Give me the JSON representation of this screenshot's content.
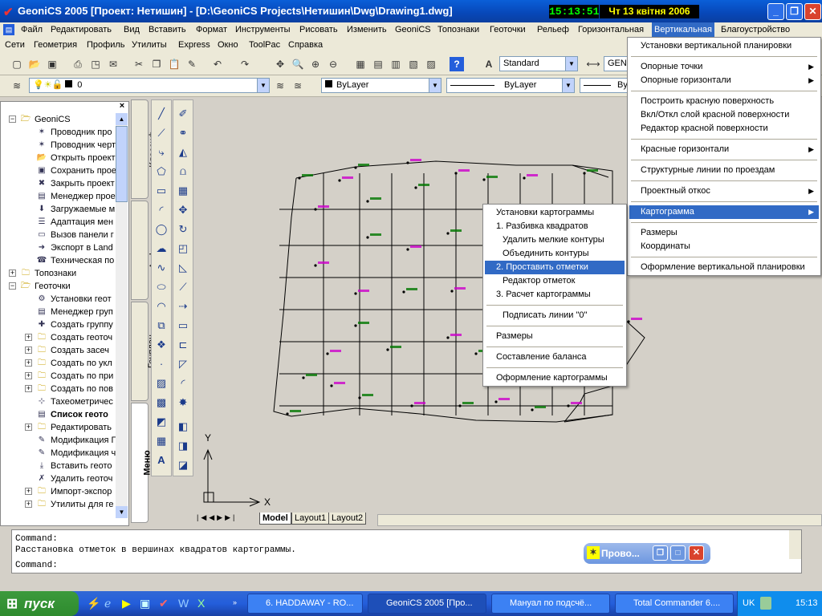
{
  "window": {
    "title": "GeoniCS 2005 [Проект: Нетишин] - [D:\\GeoniCS Projects\\Нетишин\\Dwg\\Drawing1.dwg]",
    "clock_time": "15:13:51",
    "clock_date": "Чт 13 квітня 2006"
  },
  "menubar1": [
    "Файл",
    "Редактировать",
    "Вид",
    "Вставить",
    "Формат",
    "Инструменты",
    "Рисовать",
    "Изменить",
    "GeoniCS",
    "Топознаки",
    "Геоточки",
    "Рельеф",
    "Горизонтальная",
    "Вертикальная",
    "Благоустройство"
  ],
  "menubar2": [
    "Сети",
    "Геометрия",
    "Профиль",
    "Утилиты",
    "Express",
    "Окно",
    "ToolPac",
    "Справка"
  ],
  "toolbar": {
    "text_style": "Standard",
    "dim_style_partial": "GEN",
    "layer": "0",
    "color": "ByLayer",
    "linetype": "ByLayer",
    "lineweight_partial": "By"
  },
  "tree": [
    {
      "label": "GeoniCS",
      "expander": "−",
      "level": 0,
      "icon": "folder-open"
    },
    {
      "label": "Проводник про",
      "level": 1,
      "icon": "explorer"
    },
    {
      "label": "Проводник черт",
      "level": 1,
      "icon": "explorer"
    },
    {
      "label": "Открыть проект",
      "level": 1,
      "icon": "open"
    },
    {
      "label": "Сохранить прое",
      "level": 1,
      "icon": "save"
    },
    {
      "label": "Закрыть проект",
      "level": 1,
      "icon": "close"
    },
    {
      "label": "Менеджер прое",
      "level": 1,
      "icon": "manager"
    },
    {
      "label": "Загружаемые м",
      "level": 1,
      "icon": "load"
    },
    {
      "label": "Адаптация мен",
      "level": 1,
      "icon": "menu"
    },
    {
      "label": "Вызов панели г",
      "level": 1,
      "icon": "panel"
    },
    {
      "label": "Экспорт в Land",
      "level": 1,
      "icon": "export"
    },
    {
      "label": "Техническая по",
      "level": 1,
      "icon": "help"
    },
    {
      "label": "Топознаки",
      "expander": "+",
      "level": 0,
      "icon": "folder"
    },
    {
      "label": "Геоточки",
      "expander": "−",
      "level": 0,
      "icon": "folder-open"
    },
    {
      "label": "Установки геот",
      "level": 1,
      "icon": "settings"
    },
    {
      "label": "Менеджер груп",
      "level": 1,
      "icon": "manager"
    },
    {
      "label": "Создать группу",
      "level": 1,
      "icon": "create"
    },
    {
      "label": "Создать геоточ",
      "expander": "+",
      "level": 1,
      "icon": "folder"
    },
    {
      "label": "Создать засеч",
      "expander": "+",
      "level": 1,
      "icon": "folder"
    },
    {
      "label": "Создать по укл",
      "expander": "+",
      "level": 1,
      "icon": "folder"
    },
    {
      "label": "Создать по при",
      "expander": "+",
      "level": 1,
      "icon": "folder"
    },
    {
      "label": "Создать по пов",
      "expander": "+",
      "level": 1,
      "icon": "folder"
    },
    {
      "label": "Тахеометричес",
      "level": 1,
      "icon": "tacheo"
    },
    {
      "label": "Список геото",
      "level": 1,
      "icon": "list",
      "bold": true
    },
    {
      "label": "Редактировать",
      "expander": "+",
      "level": 1,
      "icon": "folder"
    },
    {
      "label": "Модификация Г",
      "level": 1,
      "icon": "modify"
    },
    {
      "label": "Модификация ч",
      "level": 1,
      "icon": "modify"
    },
    {
      "label": "Вставить геото",
      "level": 1,
      "icon": "insert"
    },
    {
      "label": "Удалить геоточ",
      "level": 1,
      "icon": "delete"
    },
    {
      "label": "Импорт-экспор",
      "expander": "+",
      "level": 1,
      "icon": "folder"
    },
    {
      "label": "Утилиты для ге",
      "expander": "+",
      "level": 1,
      "icon": "folder"
    }
  ],
  "side_tabs": [
    "Классиф",
    "Алфавит",
    "Генплан",
    "Меню"
  ],
  "layout_tabs": [
    "Model",
    "Layout1",
    "Layout2"
  ],
  "command": {
    "line1": "Command:",
    "line2": "Расстановка отметок в вершинах квадратов картограммы.",
    "line3": "Command:"
  },
  "float_window": {
    "title": "Прово..."
  },
  "main_menu": {
    "items": [
      {
        "label": "Установки вертикальной планировки"
      },
      {
        "sep": true
      },
      {
        "label": "Опорные точки",
        "sub": true
      },
      {
        "label": "Опорные горизонтали",
        "sub": true
      },
      {
        "sep": true
      },
      {
        "label": "Построить красную поверхность"
      },
      {
        "label": "Вкл/Откл слой красной поверхности"
      },
      {
        "label": "Редактор красной поверхности"
      },
      {
        "sep": true
      },
      {
        "label": "Красные горизонтали",
        "sub": true
      },
      {
        "sep": true
      },
      {
        "label": "Структурные линии по проездам"
      },
      {
        "sep": true
      },
      {
        "label": "Проектный откос",
        "sub": true
      },
      {
        "sep": true
      },
      {
        "label": "Картограмма",
        "sub": true,
        "selected": true
      },
      {
        "sep": true
      },
      {
        "label": "Размеры"
      },
      {
        "label": "Координаты"
      },
      {
        "sep": true
      },
      {
        "label": "Оформление вертикальной планировки"
      }
    ]
  },
  "sub_menu": {
    "items": [
      {
        "label": "Установки картограммы"
      },
      {
        "label": "1. Разбивка квадратов"
      },
      {
        "label": "Удалить мелкие контуры",
        "indent": true
      },
      {
        "label": "Объединить контуры",
        "indent": true
      },
      {
        "label": "2. Проставить отметки",
        "selected": true
      },
      {
        "label": "Редактор отметок",
        "indent": true
      },
      {
        "label": "3. Расчет картограммы"
      },
      {
        "sep": true
      },
      {
        "label": "Подписать линии \"0\"",
        "indent": true
      },
      {
        "sep": true
      },
      {
        "label": "Размеры"
      },
      {
        "sep": true
      },
      {
        "label": "Составление баланса"
      },
      {
        "sep": true
      },
      {
        "label": "Оформление картограммы"
      }
    ]
  },
  "taskbar": {
    "start_label": "пуск",
    "tasks": [
      "6. HADDAWAY - RO...",
      "GeoniCS 2005 [Про...",
      "Мануал по подсчё...",
      "Total Commander 6...."
    ],
    "lang": "UK",
    "time": "15:13"
  },
  "colors": {
    "selection": "#316ac5",
    "canvas": "#d4d0c8",
    "grid": "#000000",
    "label_green": "#007700",
    "label_magenta": "#cc00cc"
  }
}
